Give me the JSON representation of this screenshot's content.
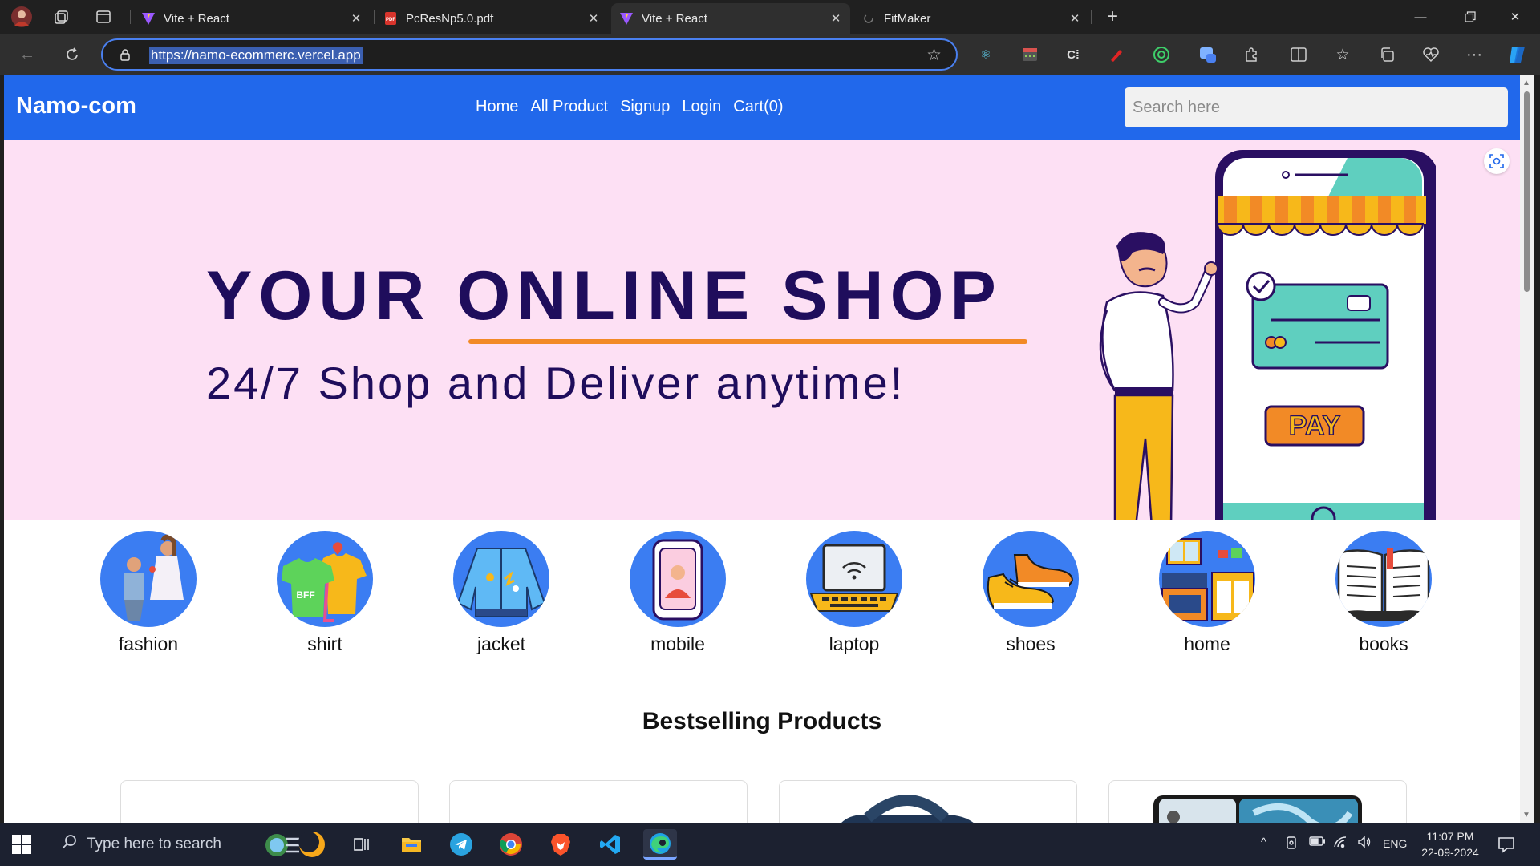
{
  "browser": {
    "tabs": [
      {
        "title": "Vite + React",
        "active": false,
        "favicon": "vite-icon"
      },
      {
        "title": "PcResNp5.0.pdf",
        "active": false,
        "favicon": "pdf-icon"
      },
      {
        "title": "Vite + React",
        "active": true,
        "favicon": "vite-icon"
      },
      {
        "title": "FitMaker",
        "active": false,
        "favicon": "loading-icon"
      }
    ],
    "url": "https://namo-ecommerc.vercel.app"
  },
  "site": {
    "brand": "Namo-com",
    "menu": [
      {
        "label": "Home"
      },
      {
        "label": "All Product"
      },
      {
        "label": "Signup"
      },
      {
        "label": "Login"
      },
      {
        "label": "Cart(0)"
      }
    ],
    "search_placeholder": "Search here",
    "hero": {
      "title": "YOUR ONLINE SHOP",
      "subtitle": "24/7 Shop and Deliver anytime!",
      "pay_label": "PAY"
    },
    "categories": [
      {
        "label": "fashion"
      },
      {
        "label": "shirt"
      },
      {
        "label": "jacket"
      },
      {
        "label": "mobile"
      },
      {
        "label": "laptop"
      },
      {
        "label": "shoes"
      },
      {
        "label": "home"
      },
      {
        "label": "books"
      }
    ],
    "section_title": "Bestselling Products"
  },
  "taskbar": {
    "search_placeholder": "Type here to search",
    "language": "ENG",
    "time": "11:07 PM",
    "date": "22-09-2024"
  },
  "colors": {
    "nav_blue": "#2168eb",
    "hero_bg": "#fde0f4",
    "hero_text": "#1f0d5c",
    "accent_orange": "#f28a26",
    "category_circle": "#3b7df2"
  }
}
